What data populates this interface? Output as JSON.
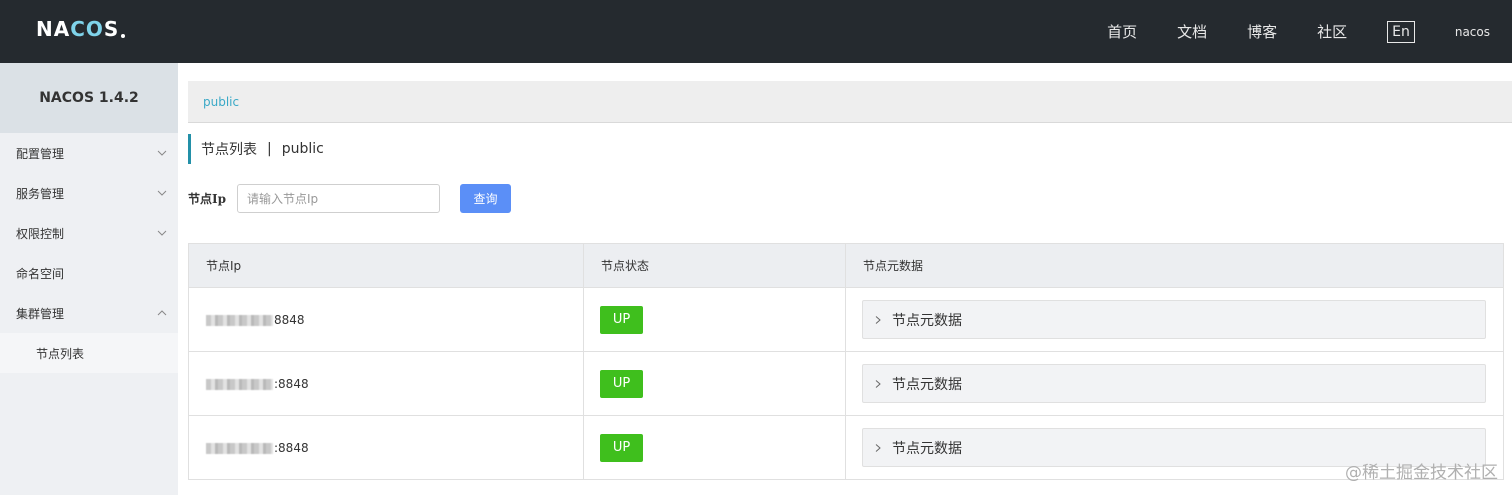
{
  "header": {
    "logo": {
      "pre": "NA",
      "oo": "CO",
      "post": "S"
    },
    "nav": [
      "首页",
      "文档",
      "博客",
      "社区"
    ],
    "lang": "En",
    "user": "nacos"
  },
  "sidebar": {
    "title": "NACOS 1.4.2",
    "items": [
      {
        "label": "配置管理",
        "chevron": "down"
      },
      {
        "label": "服务管理",
        "chevron": "down"
      },
      {
        "label": "权限控制",
        "chevron": "down"
      },
      {
        "label": "命名空间",
        "chevron": ""
      },
      {
        "label": "集群管理",
        "chevron": "up"
      }
    ],
    "sub_items": [
      "节点列表"
    ]
  },
  "namespace": {
    "active": "public"
  },
  "page": {
    "title": "节点列表",
    "separator": "|",
    "namespace": "public"
  },
  "filter": {
    "label": "节点Ip",
    "placeholder": "请输入节点Ip",
    "query_label": "查询"
  },
  "table": {
    "headers": [
      "节点Ip",
      "节点状态",
      "节点元数据"
    ],
    "rows": [
      {
        "ip_suffix": "8848",
        "status": "UP",
        "meta_label": "节点元数据"
      },
      {
        "ip_suffix": ":8848",
        "status": "UP",
        "meta_label": "节点元数据"
      },
      {
        "ip_suffix": ":8848",
        "status": "UP",
        "meta_label": "节点元数据"
      }
    ]
  },
  "watermark": "@稀土掘金技术社区",
  "colors": {
    "header_bg": "#252a2f",
    "accent": "#2390a8",
    "link": "#3aa9c7",
    "button": "#5b8ff7",
    "status_up": "#3fbf1d"
  }
}
